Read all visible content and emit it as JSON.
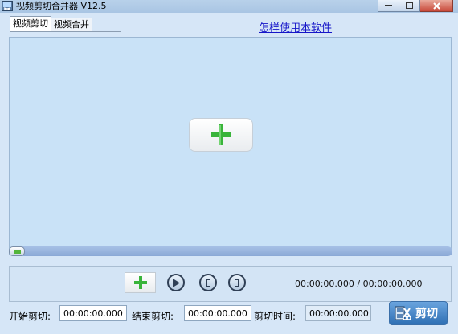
{
  "window": {
    "title": "视频剪切合并器 V12.5"
  },
  "tabs": [
    {
      "label": "视频剪切",
      "active": true
    },
    {
      "label": "视频合并",
      "active": false
    }
  ],
  "help_link": "怎样使用本软件",
  "controls": {
    "time_display": "00:00:00.000 / 00:00:00.000",
    "progress": 0
  },
  "fields": {
    "start": {
      "label": "开始剪切:",
      "value": "00:00:00.000"
    },
    "end": {
      "label": "结束剪切:",
      "value": "00:00:00.000"
    },
    "duration": {
      "label": "剪切时间:",
      "value": "00:00:00.000"
    }
  },
  "cut_button": {
    "label": "剪切"
  },
  "icons": {
    "app": "film-scissors-icon",
    "add": "green-plus-icon",
    "play": "play-icon",
    "mark_in": "bracket-left-icon",
    "mark_out": "bracket-right-icon",
    "cut": "scissors-film-icon"
  },
  "colors": {
    "accent_green": "#39b43a",
    "link": "#1515c8",
    "cut_button": "#2f6fb4"
  }
}
